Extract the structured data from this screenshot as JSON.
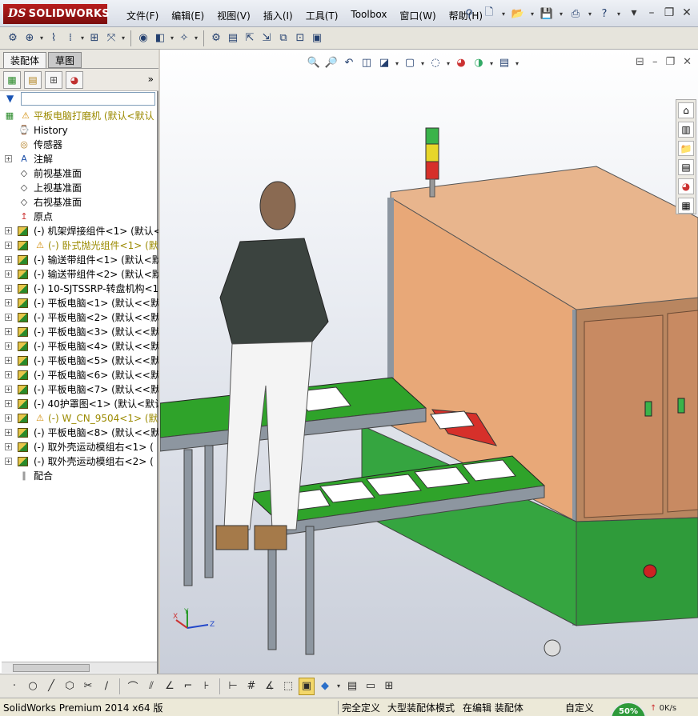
{
  "app": {
    "logo_text": "SOLIDWORKS",
    "logo_mark": "DS"
  },
  "menu": [
    "文件(F)",
    "编辑(E)",
    "视图(V)",
    "插入(I)",
    "工具(T)",
    "Toolbox",
    "窗口(W)",
    "帮助(H)"
  ],
  "title_tools": [
    "new-doc-icon",
    "open-icon",
    "save-icon",
    "print-icon",
    "help-icon"
  ],
  "window_controls": [
    "pin-icon",
    "minimize-icon",
    "restore-icon",
    "close-icon"
  ],
  "feature_manager": {
    "tabs": [
      "装配体",
      "草图"
    ],
    "active_tab": "装配体",
    "more_label": "»",
    "tree": [
      {
        "label": "平板电脑打磨机  (默认<默认",
        "icon": "assembly",
        "warn": true,
        "expand": false,
        "indent": 0,
        "warnlabel": true
      },
      {
        "label": "History",
        "icon": "history",
        "warn": false,
        "expand": false,
        "indent": 1
      },
      {
        "label": "传感器",
        "icon": "sensor",
        "warn": false,
        "expand": false,
        "indent": 1
      },
      {
        "label": "注解",
        "icon": "annotation",
        "warn": false,
        "expand": true,
        "indent": 1
      },
      {
        "label": "前视基准面",
        "icon": "plane",
        "warn": false,
        "expand": false,
        "indent": 1
      },
      {
        "label": "上视基准面",
        "icon": "plane",
        "warn": false,
        "expand": false,
        "indent": 1
      },
      {
        "label": "右视基准面",
        "icon": "plane",
        "warn": false,
        "expand": false,
        "indent": 1
      },
      {
        "label": "原点",
        "icon": "origin",
        "warn": false,
        "expand": false,
        "indent": 1
      },
      {
        "label": "(-) 机架焊接组件<1> (默认<",
        "icon": "component",
        "warn": false,
        "expand": true,
        "indent": 1
      },
      {
        "label": "(-) 卧式抛光组件<1> (默",
        "icon": "component",
        "warn": true,
        "expand": true,
        "indent": 1,
        "warnlabel": true
      },
      {
        "label": "(-) 输送带组件<1> (默认<默",
        "icon": "component",
        "warn": false,
        "expand": true,
        "indent": 1
      },
      {
        "label": "(-) 输送带组件<2> (默认<默",
        "icon": "component",
        "warn": false,
        "expand": true,
        "indent": 1
      },
      {
        "label": "(-) 10-SJTSSRP-转盘机构<1",
        "icon": "component",
        "warn": false,
        "expand": true,
        "indent": 1
      },
      {
        "label": "(-) 平板电脑<1> (默认<<默",
        "icon": "component",
        "warn": false,
        "expand": true,
        "indent": 1
      },
      {
        "label": "(-) 平板电脑<2> (默认<<默",
        "icon": "component",
        "warn": false,
        "expand": true,
        "indent": 1
      },
      {
        "label": "(-) 平板电脑<3> (默认<<默",
        "icon": "component",
        "warn": false,
        "expand": true,
        "indent": 1
      },
      {
        "label": "(-) 平板电脑<4> (默认<<默",
        "icon": "component",
        "warn": false,
        "expand": true,
        "indent": 1
      },
      {
        "label": "(-) 平板电脑<5> (默认<<默",
        "icon": "component",
        "warn": false,
        "expand": true,
        "indent": 1
      },
      {
        "label": "(-) 平板电脑<6> (默认<<默",
        "icon": "component",
        "warn": false,
        "expand": true,
        "indent": 1
      },
      {
        "label": "(-) 平板电脑<7> (默认<<默",
        "icon": "component",
        "warn": false,
        "expand": true,
        "indent": 1
      },
      {
        "label": "(-) 40护罩图<1> (默认<默认",
        "icon": "component",
        "warn": false,
        "expand": true,
        "indent": 1
      },
      {
        "label": "(-) W_CN_9504<1> (默认<",
        "icon": "component",
        "warn": true,
        "expand": true,
        "indent": 1,
        "warnlabel": true
      },
      {
        "label": "(-) 平板电脑<8> (默认<<默",
        "icon": "component",
        "warn": false,
        "expand": true,
        "indent": 1
      },
      {
        "label": "(-) 取外壳运动模组右<1> (",
        "icon": "component",
        "warn": false,
        "expand": true,
        "indent": 1
      },
      {
        "label": "(-) 取外壳运动模组右<2> (",
        "icon": "component",
        "warn": false,
        "expand": true,
        "indent": 1
      },
      {
        "label": "配合",
        "icon": "mates",
        "warn": false,
        "expand": false,
        "indent": 1
      }
    ]
  },
  "statusbar": {
    "product": "SolidWorks Premium 2014 x64 版",
    "constraint": "完全定义",
    "mode": "大型装配体模式",
    "editing": "在编辑 装配体",
    "custom": "自定义",
    "net_percent": "50%",
    "net_speed": "0K/s"
  },
  "scene_colors": {
    "cabinet": "#e8a878",
    "door": "#c88a62",
    "conveyor": "#2fa32a",
    "frame": "#9aa3ad",
    "signal_green": "#3ab34a",
    "signal_yellow": "#e7d62a",
    "signal_red": "#d6302a"
  }
}
